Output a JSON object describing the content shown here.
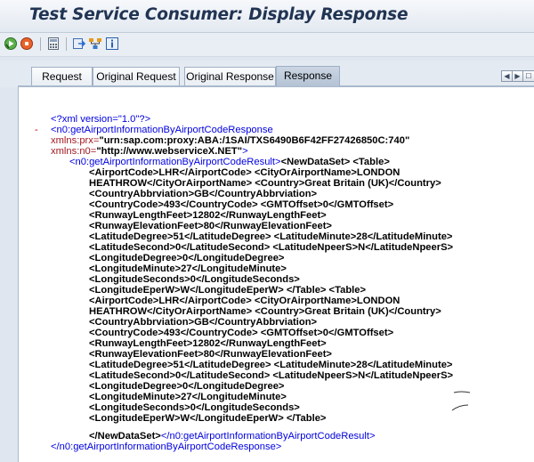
{
  "window": {
    "title": "Test Service Consumer: Display Response"
  },
  "toolbar": {
    "icons": [
      "execute-icon",
      "record-icon",
      "calculator-icon",
      "export-icon",
      "hierarchy-icon",
      "info-icon"
    ]
  },
  "tabs": [
    {
      "label": "Request",
      "active": false
    },
    {
      "label": "Original Request",
      "active": false
    },
    {
      "label": "Original Response",
      "active": false
    },
    {
      "label": "Response",
      "active": true
    }
  ],
  "tab_nav": {
    "prev": "◀",
    "next": "▶",
    "menu": "☐"
  },
  "xml": {
    "declaration": "<?xml version=\"1.0\"?>",
    "collapse_toggle": "-",
    "root_open": "<n0:getAirportInformationByAirportCodeResponse",
    "ns_prx_attr": "xmlns:prx=",
    "ns_prx_value": "\"urn:sap.com:proxy:ABA:/1SAI/TXS6490B6F42FF27426850C:740\"",
    "ns_n0_attr": "xmlns:n0=",
    "ns_n0_value": "\"http://www.webserviceX.NET\"",
    "ns_close": ">",
    "result_open": "<n0:getAirportInformationByAirportCodeResult>",
    "value_lines": [
      "<NewDataSet> <Table>",
      "<AirportCode>LHR</AirportCode> <CityOrAirportName>LONDON",
      "HEATHROW</CityOrAirportName> <Country>Great Britain (UK)</Country>",
      "<CountryAbbrviation>GB</CountryAbbrviation>",
      "<CountryCode>493</CountryCode> <GMTOffset>0</GMTOffset>",
      "<RunwayLengthFeet>12802</RunwayLengthFeet>",
      "<RunwayElevationFeet>80</RunwayElevationFeet>",
      "<LatitudeDegree>51</LatitudeDegree> <LatitudeMinute>28</LatitudeMinute>",
      "<LatitudeSecond>0</LatitudeSecond> <LatitudeNpeerS>N</LatitudeNpeerS>",
      "<LongitudeDegree>0</LongitudeDegree>",
      "<LongitudeMinute>27</LongitudeMinute>",
      "<LongitudeSeconds>0</LongitudeSeconds>",
      "<LongitudeEperW>W</LongitudeEperW> </Table> <Table>",
      "<AirportCode>LHR</AirportCode> <CityOrAirportName>LONDON",
      "HEATHROW</CityOrAirportName> <Country>Great Britain (UK)</Country>",
      "<CountryAbbrviation>GB</CountryAbbrviation>",
      "<CountryCode>493</CountryCode> <GMTOffset>0</GMTOffset>",
      "<RunwayLengthFeet>12802</RunwayLengthFeet>",
      "<RunwayElevationFeet>80</RunwayElevationFeet>",
      "<LatitudeDegree>51</LatitudeDegree> <LatitudeMinute>28</LatitudeMinute>",
      "<LatitudeSecond>0</LatitudeSecond> <LatitudeNpeerS>N</LatitudeNpeerS>",
      "<LongitudeDegree>0</LongitudeDegree>",
      "<LongitudeMinute>27</LongitudeMinute>",
      "<LongitudeSeconds>0</LongitudeSeconds>",
      "<LongitudeEperW>W</LongitudeEperW> </Table>"
    ],
    "last_value": "</NewDataSet>",
    "result_close": "</n0:getAirportInformationByAirportCodeResult>",
    "root_close": "</n0:getAirportInformationByAirportCodeResponse>"
  },
  "colors": {
    "tag": "#0000e0",
    "attr_value": "#a3171f",
    "value": "#000000",
    "title": "#213453",
    "active_tab": "#b3c2d4"
  }
}
